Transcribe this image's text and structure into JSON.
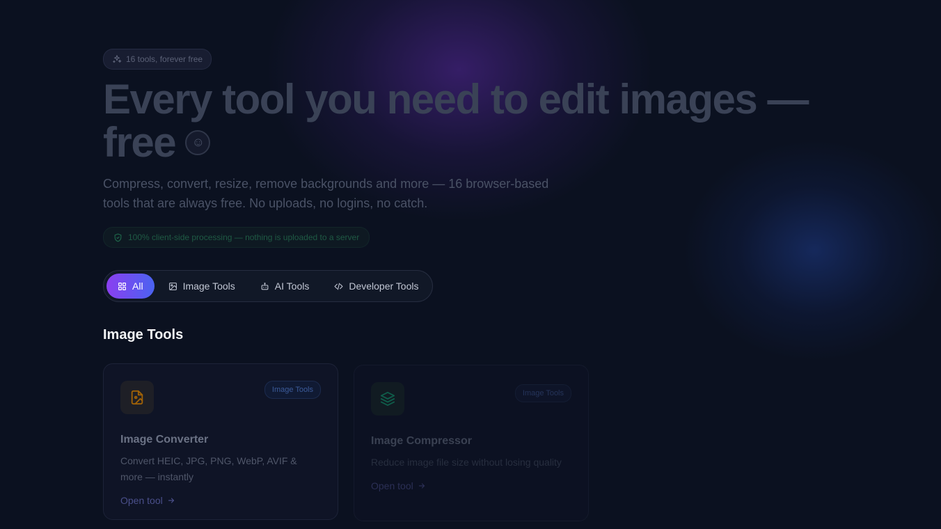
{
  "hero": {
    "badge_text": "16 tools, forever free",
    "title": "Every tool you need to edit images — free",
    "subtitle": "Compress, convert, resize, remove backgrounds and more — 16 browser-based tools that are always free. No uploads, no logins, no catch.",
    "privacy_text": "100% client-side processing — nothing is uploaded to a server"
  },
  "filters": [
    {
      "label": "All",
      "icon": "grid-icon",
      "active": true
    },
    {
      "label": "Image Tools",
      "icon": "image-icon",
      "active": false
    },
    {
      "label": "AI Tools",
      "icon": "bot-icon",
      "active": false
    },
    {
      "label": "Developer Tools",
      "icon": "code-icon",
      "active": false
    }
  ],
  "section": {
    "title": "Image Tools"
  },
  "cards": [
    {
      "title": "Image Converter",
      "description": "Convert HEIC, JPG, PNG, WebP, AVIF & more — instantly",
      "tag": "Image Tools",
      "link": "Open tool",
      "icon": "file-image-icon",
      "icon_color": "#a16207"
    },
    {
      "title": "Image Compressor",
      "description": "Reduce image file size without losing quality",
      "tag": "Image Tools",
      "link": "Open tool",
      "icon": "layers-icon",
      "icon_color": "#0f5c4a"
    }
  ],
  "colors": {
    "background": "#0b1120",
    "accent_start": "#8b3ff0",
    "accent_end": "#4a63f0"
  }
}
